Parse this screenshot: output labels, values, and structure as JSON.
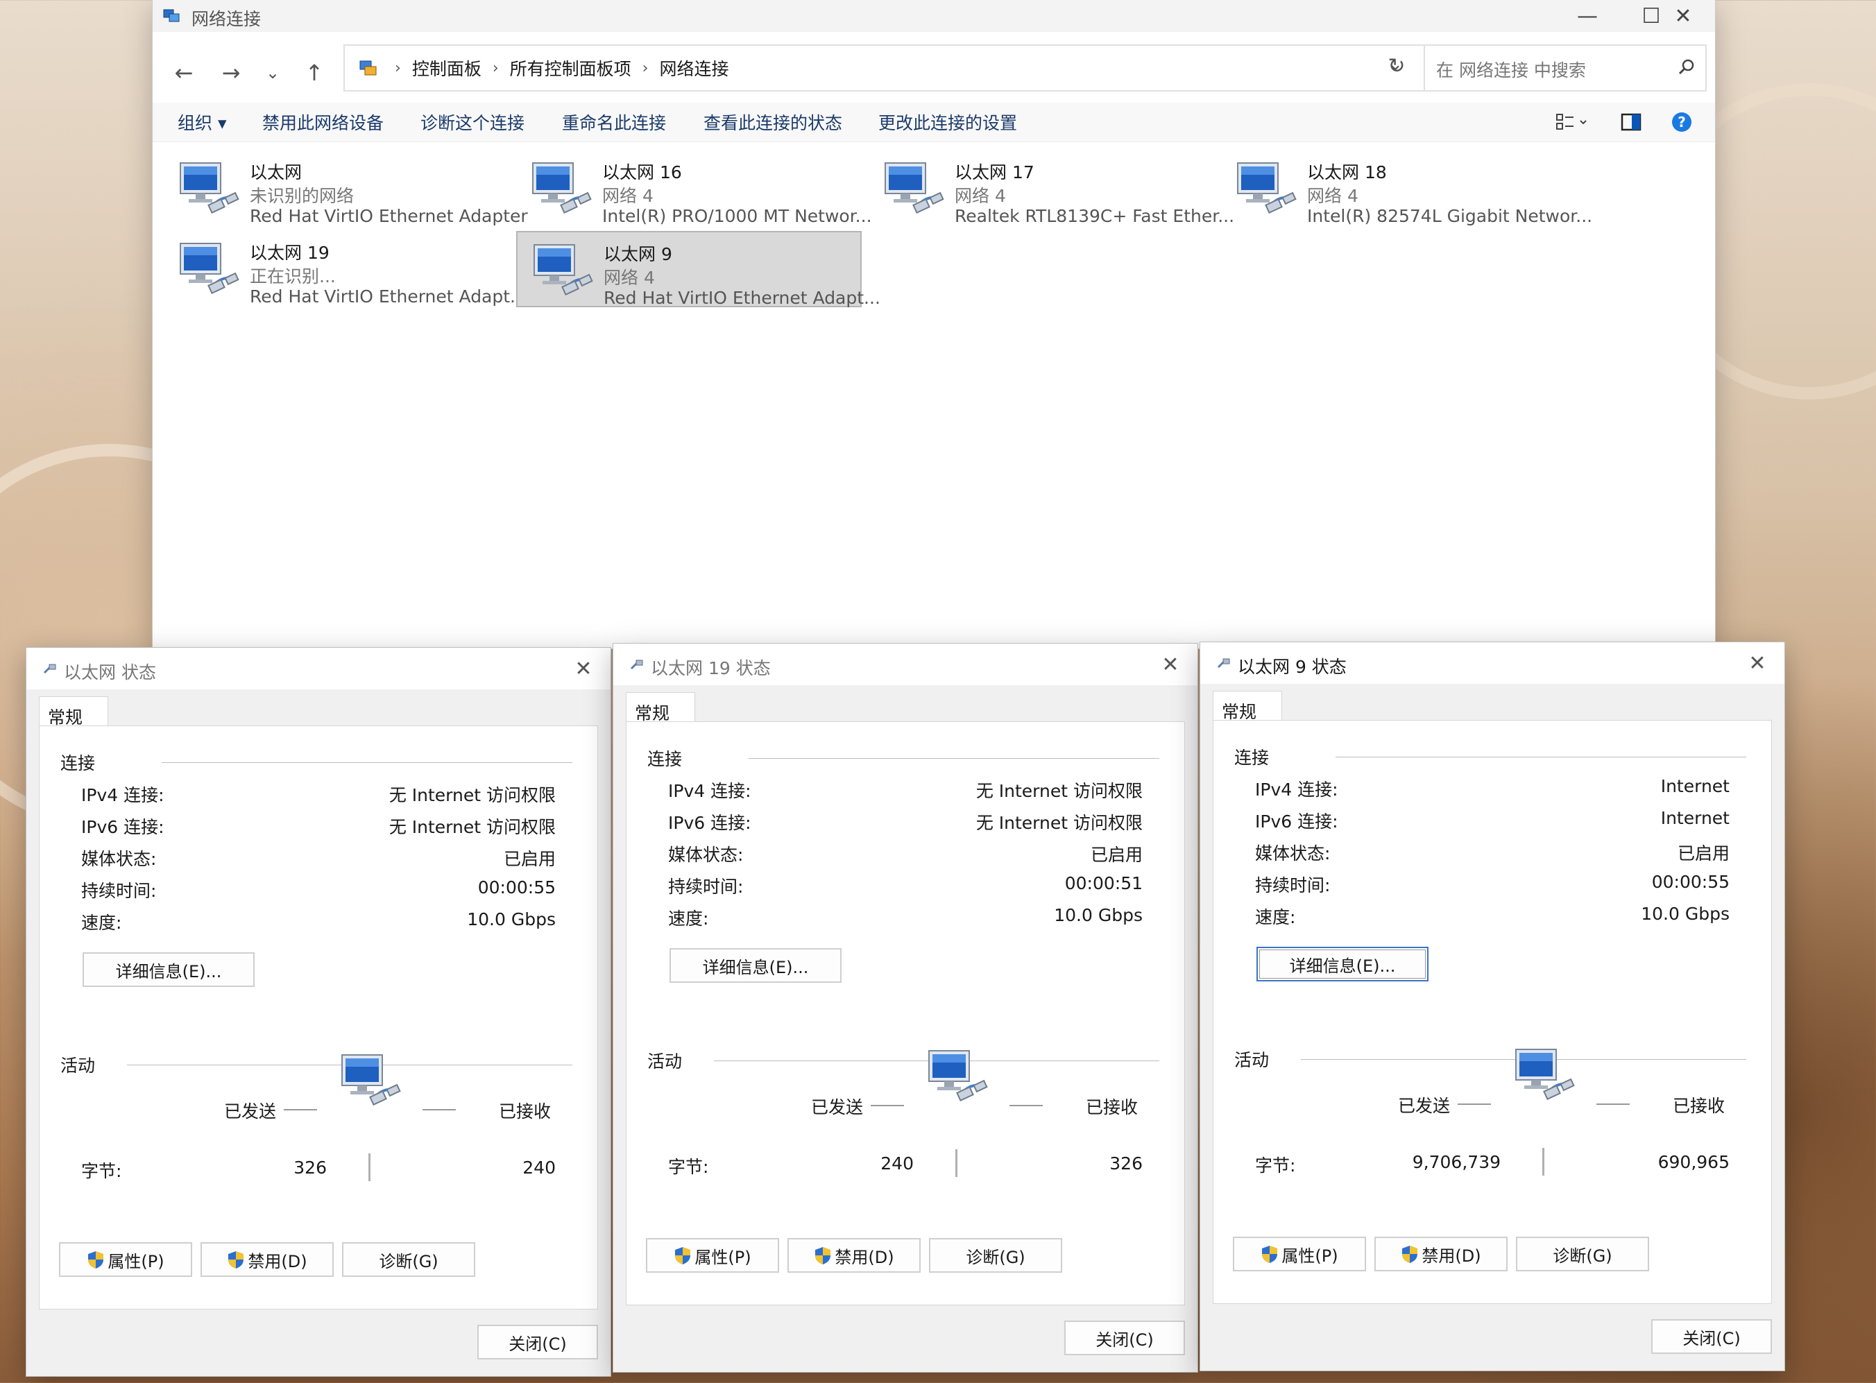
{
  "explorer": {
    "title": "网络连接",
    "breadcrumb": [
      "控制面板",
      "所有控制面板项",
      "网络连接"
    ],
    "search_placeholder": "在 网络连接 中搜索",
    "commands": [
      "组织 ▾",
      "禁用此网络设备",
      "诊断这个连接",
      "重命名此连接",
      "查看此连接的状态",
      "更改此连接的设置"
    ],
    "connections": [
      {
        "name": "以太网",
        "network": "未识别的网络",
        "adapter": "Red Hat VirtIO Ethernet Adapter",
        "selected": false
      },
      {
        "name": "以太网 16",
        "network": "网络 4",
        "adapter": "Intel(R) PRO/1000 MT Networ...",
        "selected": false
      },
      {
        "name": "以太网 17",
        "network": "网络 4",
        "adapter": "Realtek RTL8139C+ Fast Ether...",
        "selected": false
      },
      {
        "name": "以太网 18",
        "network": "网络 4",
        "adapter": "Intel(R) 82574L Gigabit Networ...",
        "selected": false
      },
      {
        "name": "以太网 19",
        "network": "正在识别...",
        "adapter": "Red Hat VirtIO Ethernet Adapt...",
        "selected": false
      },
      {
        "name": "以太网 9",
        "network": "网络 4",
        "adapter": "Red Hat VirtIO Ethernet Adapt...",
        "selected": true
      }
    ]
  },
  "labels": {
    "tab_general": "常规",
    "connection": "连接",
    "ipv4": "IPv4 连接:",
    "ipv6": "IPv6 连接:",
    "media": "媒体状态:",
    "duration": "持续时间:",
    "speed": "速度:",
    "details": "详细信息(E)...",
    "activity": "活动",
    "sent": "已发送",
    "received": "已接收",
    "bytes": "字节:",
    "properties": "属性(P)",
    "disable": "禁用(D)",
    "diagnose": "诊断(G)",
    "close": "关闭(C)"
  },
  "dialogs": [
    {
      "title": "以太网 状态",
      "ipv4": "无 Internet 访问权限",
      "ipv6": "无 Internet 访问权限",
      "media": "已启用",
      "duration": "00:00:55",
      "speed": "10.0 Gbps",
      "sent_bytes": "326",
      "received_bytes": "240"
    },
    {
      "title": "以太网 19 状态",
      "ipv4": "无 Internet 访问权限",
      "ipv6": "无 Internet 访问权限",
      "media": "已启用",
      "duration": "00:00:51",
      "speed": "10.0 Gbps",
      "sent_bytes": "240",
      "received_bytes": "326"
    },
    {
      "title": "以太网 9 状态",
      "ipv4": "Internet",
      "ipv6": "Internet",
      "media": "已启用",
      "duration": "00:00:55",
      "speed": "10.0 Gbps",
      "sent_bytes": "9,706,739",
      "received_bytes": "690,965"
    }
  ]
}
